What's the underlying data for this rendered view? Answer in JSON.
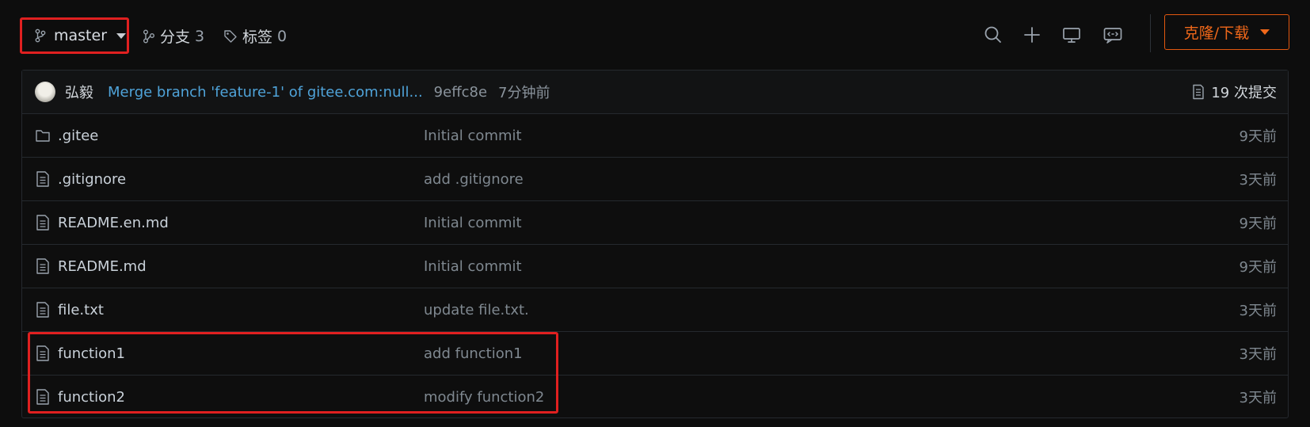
{
  "toolbar": {
    "branch": "master",
    "branches_label": "分支",
    "branches_count": "3",
    "tags_label": "标签",
    "tags_count": "0",
    "clone_label": "克隆/下载"
  },
  "last_commit": {
    "author": "弘毅",
    "message": "Merge branch 'feature-1' of gitee.com:null...",
    "sha": "9effc8e",
    "time": "7分钟前",
    "commits_count": "19 次提交"
  },
  "files": [
    {
      "name": ".gitee",
      "type": "folder",
      "message": "Initial commit",
      "time": "9天前"
    },
    {
      "name": ".gitignore",
      "type": "file",
      "message": "add .gitignore",
      "time": "3天前"
    },
    {
      "name": "README.en.md",
      "type": "file",
      "message": "Initial commit",
      "time": "9天前"
    },
    {
      "name": "README.md",
      "type": "file",
      "message": "Initial commit",
      "time": "9天前"
    },
    {
      "name": "file.txt",
      "type": "file",
      "message": "update file.txt.",
      "time": "3天前"
    },
    {
      "name": "function1",
      "type": "file",
      "message": "add function1",
      "time": "3天前"
    },
    {
      "name": "function2",
      "type": "file",
      "message": "modify function2",
      "time": "3天前"
    }
  ],
  "colors": {
    "accent_orange": "#f0681a",
    "link_blue": "#4fa3d9",
    "highlight_red": "#e02020"
  }
}
